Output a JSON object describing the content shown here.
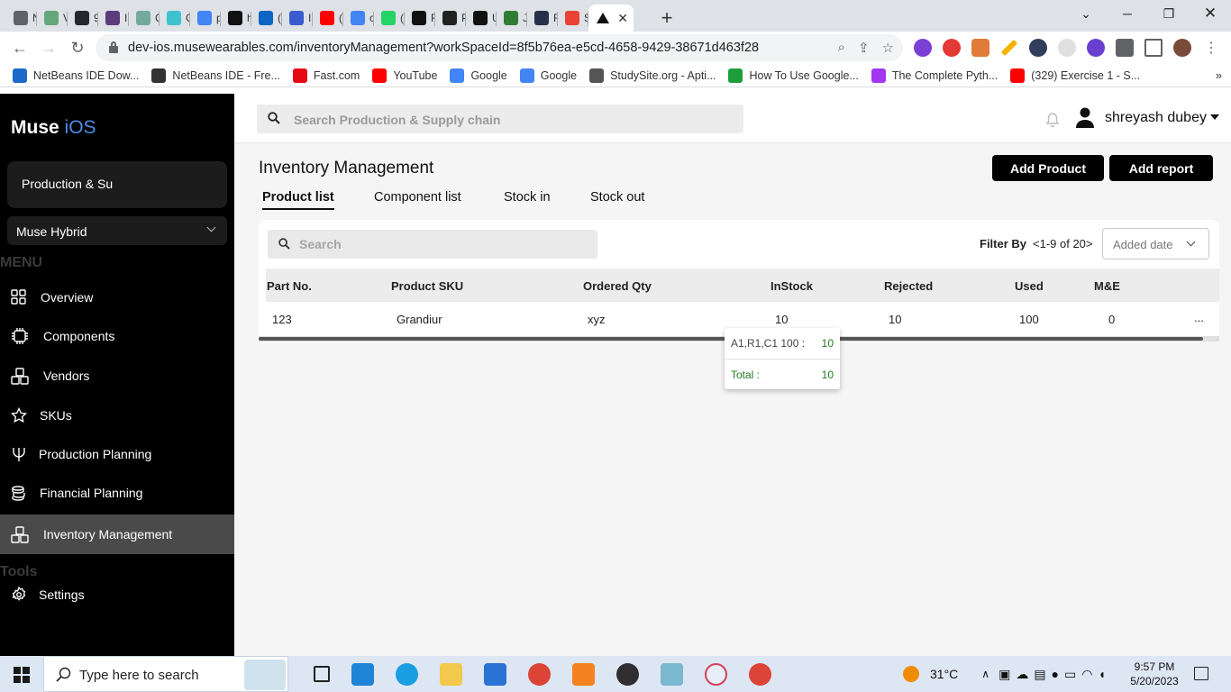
{
  "browser": {
    "tabs": [
      {
        "label": "Ne",
        "color": "#5f6368"
      },
      {
        "label": "Vik",
        "color": "#64a77a"
      },
      {
        "label": "93",
        "color": "#24292f"
      },
      {
        "label": "Int",
        "color": "#5c3c7a"
      },
      {
        "label": "CS",
        "color": "#74aa9c"
      },
      {
        "label": "Gla",
        "color": "#3ec2cf"
      },
      {
        "label": "po",
        "color": "#4285f4"
      },
      {
        "label": "htt",
        "color": "#111111"
      },
      {
        "label": "(17",
        "color": "#0a66c2"
      },
      {
        "label": "Ins",
        "color": "#3b5ccf"
      },
      {
        "label": "(18",
        "color": "#ff0000"
      },
      {
        "label": "crc",
        "color": "#4285f4"
      },
      {
        "label": "(2)",
        "color": "#25d366"
      },
      {
        "label": "Frc",
        "color": "#111111"
      },
      {
        "label": "PR",
        "color": "#222222"
      },
      {
        "label": "Us",
        "color": "#111111"
      },
      {
        "label": "Jav",
        "color": "#2f7d32"
      },
      {
        "label": "Re",
        "color": "#28304a"
      },
      {
        "label": "Se",
        "color": "#ea4335"
      }
    ],
    "active_tab_close": "✕",
    "new_tab": "+",
    "url": "dev-ios.musewearables.com/inventoryManagement?workSpaceId=8f5b76ea-e5cd-4658-9429-38671d463f28",
    "bookmarks": [
      {
        "label": "NetBeans IDE Dow...",
        "color": "#1b6ac9"
      },
      {
        "label": "NetBeans IDE - Fre...",
        "color": "#333333"
      },
      {
        "label": "Fast.com",
        "color": "#e50914"
      },
      {
        "label": "YouTube",
        "color": "#ff0000"
      },
      {
        "label": "Google",
        "color": "#4285f4"
      },
      {
        "label": "Google",
        "color": "#4285f4"
      },
      {
        "label": "StudySite.org - Apti...",
        "color": "#555555"
      },
      {
        "label": "How To Use Google...",
        "color": "#1e9e3a"
      },
      {
        "label": "The Complete Pyth...",
        "color": "#a435f0"
      },
      {
        "label": "(329) Exercise 1 - S...",
        "color": "#ff0000"
      }
    ],
    "bookmarks_more": "»"
  },
  "sidebar": {
    "brand_main": "Muse",
    "brand_accent": "iOS",
    "workspace_card": "Production & Su",
    "workspace_select": "Muse Hybrid",
    "menu_heading": "MENU",
    "tools_heading": "Tools",
    "items": [
      {
        "label": "Overview",
        "icon": "grid-icon"
      },
      {
        "label": "Components",
        "icon": "chip-icon"
      },
      {
        "label": "Vendors",
        "icon": "vendors-icon"
      },
      {
        "label": "SKUs",
        "icon": "star-icon"
      },
      {
        "label": "Production Planning",
        "icon": "trident-icon"
      },
      {
        "label": "Financial Planning",
        "icon": "coins-icon"
      },
      {
        "label": "Inventory Management",
        "icon": "boxes-icon"
      }
    ],
    "settings_label": "Settings"
  },
  "topbar": {
    "search_placeholder": "Search Production & Supply chain",
    "username": "shreyash dubey"
  },
  "page": {
    "title": "Inventory Management",
    "add_product": "Add Product",
    "add_report": "Add report",
    "tabs": [
      "Product list",
      "Component list",
      "Stock in",
      "Stock out"
    ],
    "search_placeholder": "Search",
    "filter_label": "Filter By",
    "pager": "<1-9 of 20>",
    "sort_value": "Added date",
    "columns": [
      "Part No.",
      "Product SKU",
      "Ordered Qty",
      "InStock",
      "Rejected",
      "Used",
      "M&E"
    ],
    "rows": [
      {
        "part_no": "123",
        "sku": "Grandiur",
        "ordered": "xyz",
        "instock": "10",
        "rejected": "10",
        "used": "100",
        "me": "0",
        "more": "..."
      }
    ],
    "popover": {
      "location_key": "A1,R1,C1 100 :",
      "location_val": "10",
      "total_key": "Total :",
      "total_val": "10"
    }
  },
  "taskbar": {
    "search_placeholder": "Type here to search",
    "temperature": "31°C",
    "time": "9:57 PM",
    "date": "5/20/2023"
  }
}
